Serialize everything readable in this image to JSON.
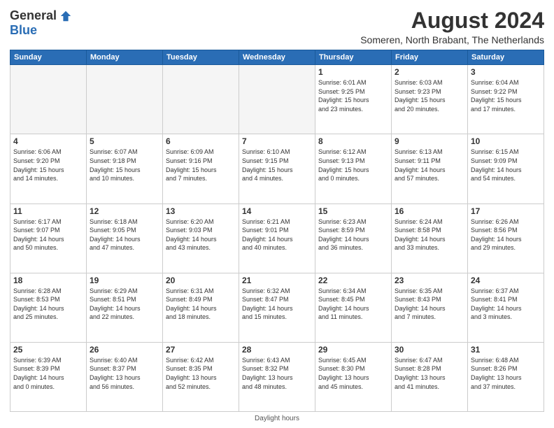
{
  "header": {
    "logo_general": "General",
    "logo_blue": "Blue",
    "month_year": "August 2024",
    "location": "Someren, North Brabant, The Netherlands"
  },
  "days_of_week": [
    "Sunday",
    "Monday",
    "Tuesday",
    "Wednesday",
    "Thursday",
    "Friday",
    "Saturday"
  ],
  "footer": {
    "note": "Daylight hours"
  },
  "weeks": [
    [
      {
        "day": "",
        "info": ""
      },
      {
        "day": "",
        "info": ""
      },
      {
        "day": "",
        "info": ""
      },
      {
        "day": "",
        "info": ""
      },
      {
        "day": "1",
        "info": "Sunrise: 6:01 AM\nSunset: 9:25 PM\nDaylight: 15 hours\nand 23 minutes."
      },
      {
        "day": "2",
        "info": "Sunrise: 6:03 AM\nSunset: 9:23 PM\nDaylight: 15 hours\nand 20 minutes."
      },
      {
        "day": "3",
        "info": "Sunrise: 6:04 AM\nSunset: 9:22 PM\nDaylight: 15 hours\nand 17 minutes."
      }
    ],
    [
      {
        "day": "4",
        "info": "Sunrise: 6:06 AM\nSunset: 9:20 PM\nDaylight: 15 hours\nand 14 minutes."
      },
      {
        "day": "5",
        "info": "Sunrise: 6:07 AM\nSunset: 9:18 PM\nDaylight: 15 hours\nand 10 minutes."
      },
      {
        "day": "6",
        "info": "Sunrise: 6:09 AM\nSunset: 9:16 PM\nDaylight: 15 hours\nand 7 minutes."
      },
      {
        "day": "7",
        "info": "Sunrise: 6:10 AM\nSunset: 9:15 PM\nDaylight: 15 hours\nand 4 minutes."
      },
      {
        "day": "8",
        "info": "Sunrise: 6:12 AM\nSunset: 9:13 PM\nDaylight: 15 hours\nand 0 minutes."
      },
      {
        "day": "9",
        "info": "Sunrise: 6:13 AM\nSunset: 9:11 PM\nDaylight: 14 hours\nand 57 minutes."
      },
      {
        "day": "10",
        "info": "Sunrise: 6:15 AM\nSunset: 9:09 PM\nDaylight: 14 hours\nand 54 minutes."
      }
    ],
    [
      {
        "day": "11",
        "info": "Sunrise: 6:17 AM\nSunset: 9:07 PM\nDaylight: 14 hours\nand 50 minutes."
      },
      {
        "day": "12",
        "info": "Sunrise: 6:18 AM\nSunset: 9:05 PM\nDaylight: 14 hours\nand 47 minutes."
      },
      {
        "day": "13",
        "info": "Sunrise: 6:20 AM\nSunset: 9:03 PM\nDaylight: 14 hours\nand 43 minutes."
      },
      {
        "day": "14",
        "info": "Sunrise: 6:21 AM\nSunset: 9:01 PM\nDaylight: 14 hours\nand 40 minutes."
      },
      {
        "day": "15",
        "info": "Sunrise: 6:23 AM\nSunset: 8:59 PM\nDaylight: 14 hours\nand 36 minutes."
      },
      {
        "day": "16",
        "info": "Sunrise: 6:24 AM\nSunset: 8:58 PM\nDaylight: 14 hours\nand 33 minutes."
      },
      {
        "day": "17",
        "info": "Sunrise: 6:26 AM\nSunset: 8:56 PM\nDaylight: 14 hours\nand 29 minutes."
      }
    ],
    [
      {
        "day": "18",
        "info": "Sunrise: 6:28 AM\nSunset: 8:53 PM\nDaylight: 14 hours\nand 25 minutes."
      },
      {
        "day": "19",
        "info": "Sunrise: 6:29 AM\nSunset: 8:51 PM\nDaylight: 14 hours\nand 22 minutes."
      },
      {
        "day": "20",
        "info": "Sunrise: 6:31 AM\nSunset: 8:49 PM\nDaylight: 14 hours\nand 18 minutes."
      },
      {
        "day": "21",
        "info": "Sunrise: 6:32 AM\nSunset: 8:47 PM\nDaylight: 14 hours\nand 15 minutes."
      },
      {
        "day": "22",
        "info": "Sunrise: 6:34 AM\nSunset: 8:45 PM\nDaylight: 14 hours\nand 11 minutes."
      },
      {
        "day": "23",
        "info": "Sunrise: 6:35 AM\nSunset: 8:43 PM\nDaylight: 14 hours\nand 7 minutes."
      },
      {
        "day": "24",
        "info": "Sunrise: 6:37 AM\nSunset: 8:41 PM\nDaylight: 14 hours\nand 3 minutes."
      }
    ],
    [
      {
        "day": "25",
        "info": "Sunrise: 6:39 AM\nSunset: 8:39 PM\nDaylight: 14 hours\nand 0 minutes."
      },
      {
        "day": "26",
        "info": "Sunrise: 6:40 AM\nSunset: 8:37 PM\nDaylight: 13 hours\nand 56 minutes."
      },
      {
        "day": "27",
        "info": "Sunrise: 6:42 AM\nSunset: 8:35 PM\nDaylight: 13 hours\nand 52 minutes."
      },
      {
        "day": "28",
        "info": "Sunrise: 6:43 AM\nSunset: 8:32 PM\nDaylight: 13 hours\nand 48 minutes."
      },
      {
        "day": "29",
        "info": "Sunrise: 6:45 AM\nSunset: 8:30 PM\nDaylight: 13 hours\nand 45 minutes."
      },
      {
        "day": "30",
        "info": "Sunrise: 6:47 AM\nSunset: 8:28 PM\nDaylight: 13 hours\nand 41 minutes."
      },
      {
        "day": "31",
        "info": "Sunrise: 6:48 AM\nSunset: 8:26 PM\nDaylight: 13 hours\nand 37 minutes."
      }
    ]
  ]
}
